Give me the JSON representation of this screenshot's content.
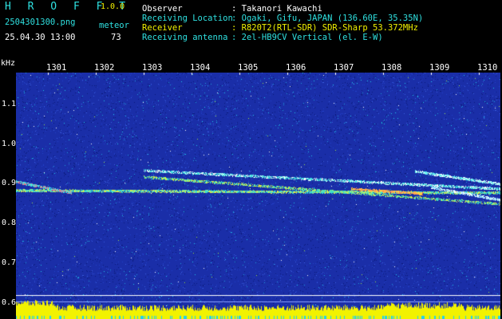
{
  "app": {
    "name": "H R O F F T",
    "version": "1.0.0"
  },
  "file": {
    "name": "2504301300.png",
    "datetime": "25.04.30 13:00"
  },
  "meteor": {
    "label": "meteor",
    "count": "73"
  },
  "info": [
    {
      "label": "Observer",
      "value": ": Takanori Kawachi"
    },
    {
      "label": "Receiving Location",
      "value": ": Ogaki, Gifu, JAPAN (136.60E, 35.35N)"
    },
    {
      "label": "Receiver",
      "value": ": R820T2(RTL-SDR) SDR-Sharp 53.372MHz"
    },
    {
      "label": "Receiving antenna",
      "value": ": 2el-HB9CV Vertical (el. E-W)"
    }
  ],
  "axis": {
    "unit": "kHz",
    "y_ticks": [
      "1.1",
      "1.0",
      "0.9",
      "0.8",
      "0.7",
      "0.6"
    ],
    "x_ticks": [
      "1301",
      "1302",
      "1303",
      "1304",
      "1305",
      "1306",
      "1307",
      "1308",
      "1309",
      "1310"
    ]
  },
  "colors": {
    "background": "#1a2ea8",
    "label_cyan": "#2fe0e0",
    "label_yellow": "#f2f200",
    "baseline": "#f2f200"
  }
}
